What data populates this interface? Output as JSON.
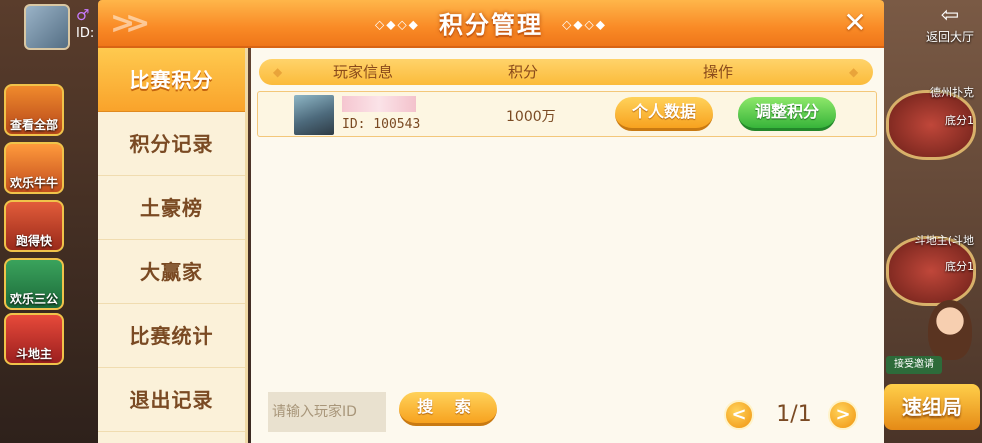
{
  "lobby": {
    "user_id_label": "ID:",
    "games": [
      "查看全部",
      "欢乐牛牛",
      "跑得快",
      "欢乐三公",
      "斗地主"
    ],
    "back_label": "返回大厅",
    "tables": [
      "德州扑克",
      "底分1",
      "斗地主(斗地",
      "底分1"
    ],
    "accept_invite": "接受邀请",
    "quick_match": "速组局"
  },
  "dialog": {
    "title": "积分管理",
    "title_deco": "◇◆◇◆"
  },
  "sidebar": {
    "items": [
      {
        "label": "比赛积分",
        "active": true
      },
      {
        "label": "积分记录",
        "active": false
      },
      {
        "label": "土豪榜",
        "active": false
      },
      {
        "label": "大赢家",
        "active": false
      },
      {
        "label": "比赛统计",
        "active": false
      },
      {
        "label": "退出记录",
        "active": false
      }
    ]
  },
  "table": {
    "headers": [
      "玩家信息",
      "积分",
      "操作"
    ],
    "rows": [
      {
        "player_id": "ID: 100543",
        "score": "1000万",
        "action_personal": "个人数据",
        "action_adjust": "调整积分"
      }
    ]
  },
  "search": {
    "placeholder": "请输入玩家ID",
    "button": "搜 索"
  },
  "pagination": {
    "text": "1/1"
  },
  "colors": {
    "header_orange": "#f98a26",
    "accent_yellow": "#f7a21f",
    "accent_green": "#37b43a",
    "text_brown": "#7a4a23"
  }
}
